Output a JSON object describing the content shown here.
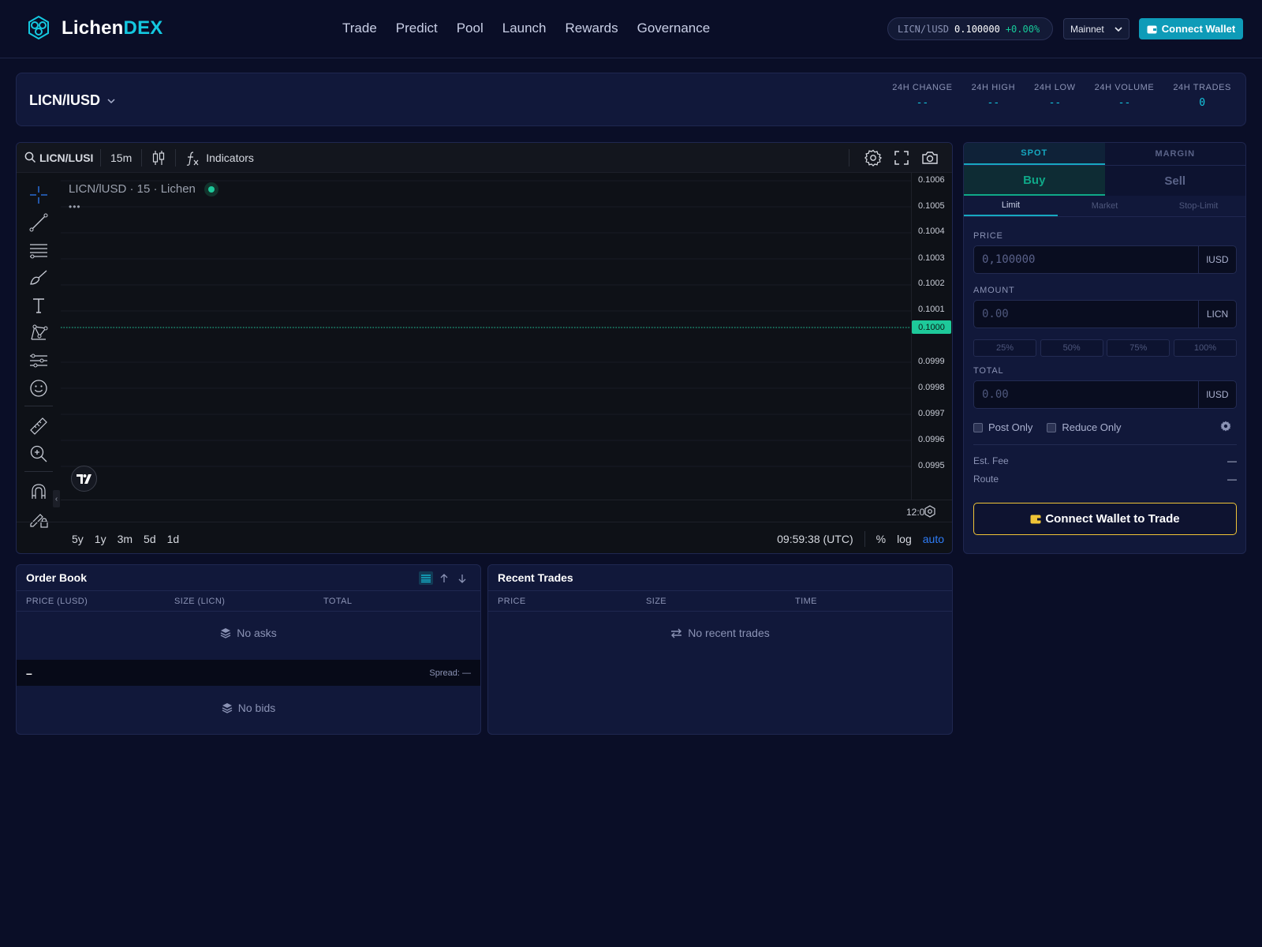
{
  "brand": {
    "name_a": "Lichen",
    "name_b": "DEX"
  },
  "nav": [
    "Trade",
    "Predict",
    "Pool",
    "Launch",
    "Rewards",
    "Governance"
  ],
  "ticker": {
    "symbol": "LICN/lUSD",
    "price": "0.100000",
    "change": "+0.00%"
  },
  "network": {
    "selected": "Mainnet"
  },
  "wallet_button": "Connect Wallet",
  "market": {
    "pair": "LICN/lUSD",
    "stats": [
      {
        "label": "24H CHANGE",
        "value": "--"
      },
      {
        "label": "24H HIGH",
        "value": "--"
      },
      {
        "label": "24H LOW",
        "value": "--"
      },
      {
        "label": "24H VOLUME",
        "value": "--"
      },
      {
        "label": "24H TRADES",
        "value": "0"
      }
    ]
  },
  "chart": {
    "symbol_search": "LICN/LUSI",
    "interval": "15m",
    "indicators_label": "Indicators",
    "legend": "LICN/lUSD · 15 · Lichen",
    "legend_more": "•••",
    "y_ticks": [
      "0.1006",
      "0.1005",
      "0.1004",
      "0.1003",
      "0.1002",
      "0.1001",
      "0.0999",
      "0.0998",
      "0.0997",
      "0.0996",
      "0.0995"
    ],
    "last_price": "0.1000",
    "x_tick": "12:0",
    "ranges": [
      "5y",
      "1y",
      "3m",
      "5d",
      "1d"
    ],
    "clock": "09:59:38 (UTC)",
    "percent_label": "%",
    "log_label": "log",
    "auto_label": "auto",
    "collapse_glyph": "‹"
  },
  "order_form": {
    "modes": [
      "SPOT",
      "MARGIN"
    ],
    "sides": [
      "Buy",
      "Sell"
    ],
    "types": [
      "Limit",
      "Market",
      "Stop-Limit"
    ],
    "price_label": "PRICE",
    "price_value": "0,100000",
    "price_unit": "lUSD",
    "amount_label": "AMOUNT",
    "amount_placeholder": "0.00",
    "amount_unit": "LICN",
    "percents": [
      "25%",
      "50%",
      "75%",
      "100%"
    ],
    "total_label": "TOTAL",
    "total_placeholder": "0.00",
    "total_unit": "lUSD",
    "post_only": "Post Only",
    "reduce_only": "Reduce Only",
    "est_fee_label": "Est. Fee",
    "est_fee_value": "—",
    "route_label": "Route",
    "route_value": "—",
    "cta": "Connect Wallet to Trade"
  },
  "order_book": {
    "title": "Order Book",
    "columns": [
      "PRICE (LUSD)",
      "SIZE (LICN)",
      "TOTAL"
    ],
    "no_asks": "No asks",
    "mid": "–",
    "spread": "Spread: —",
    "no_bids": "No bids"
  },
  "recent_trades": {
    "title": "Recent Trades",
    "columns": [
      "PRICE",
      "SIZE",
      "TIME"
    ],
    "empty": "No recent trades"
  }
}
